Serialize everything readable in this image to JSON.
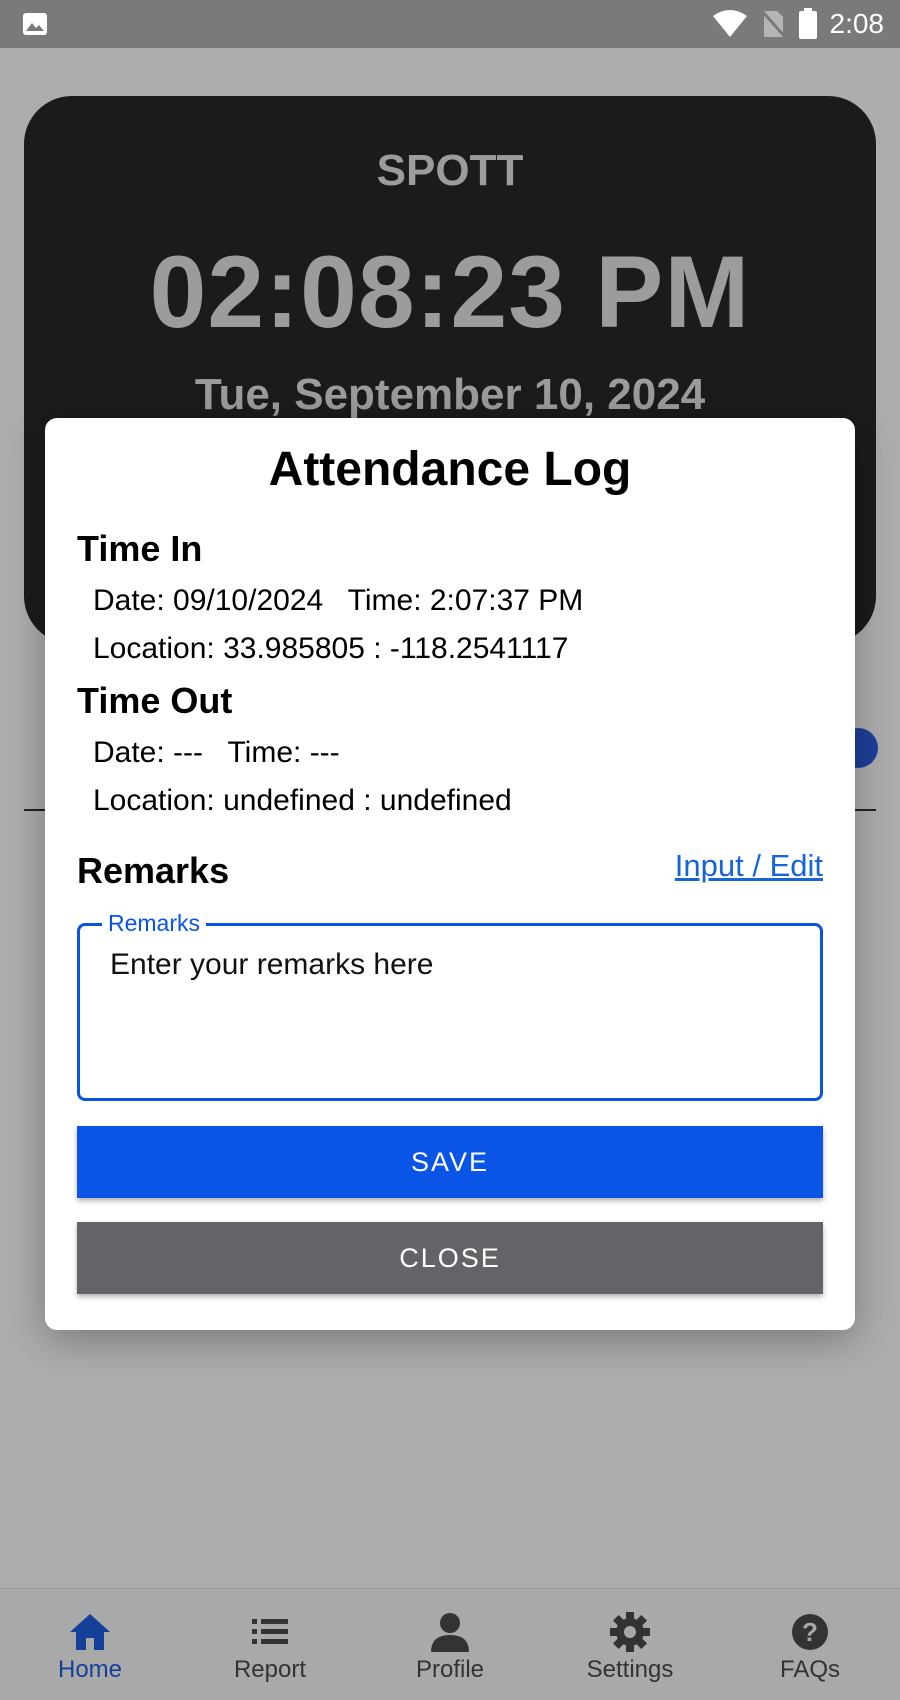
{
  "status_bar": {
    "time": "2:08"
  },
  "background": {
    "app_name": "SPOTT",
    "clock_time": "02:08:23 PM",
    "clock_date": "Tue, September 10, 2024"
  },
  "modal": {
    "title": "Attendance Log",
    "time_in": {
      "heading": "Time In",
      "date_time": "Date: 09/10/2024   Time: 2:07:37 PM",
      "location": "Location: 33.985805 : -118.2541117"
    },
    "time_out": {
      "heading": "Time Out",
      "date_time": "Date: ---   Time: ---",
      "location": "Location: undefined : undefined"
    },
    "remarks": {
      "heading": "Remarks",
      "edit_link": "Input / Edit",
      "field_label": "Remarks",
      "placeholder": "Enter your remarks here"
    },
    "save_label": "SAVE",
    "close_label": "CLOSE"
  },
  "bottom_nav": {
    "items": [
      {
        "label": "Home",
        "icon": "home-icon",
        "active": true
      },
      {
        "label": "Report",
        "icon": "list-icon",
        "active": false
      },
      {
        "label": "Profile",
        "icon": "person-icon",
        "active": false
      },
      {
        "label": "Settings",
        "icon": "gear-icon",
        "active": false
      },
      {
        "label": "FAQs",
        "icon": "help-icon",
        "active": false
      }
    ]
  },
  "colors": {
    "accent": "#0a55e5",
    "close_button": "#636468",
    "link": "#1565d8",
    "active_nav": "#14409a"
  }
}
